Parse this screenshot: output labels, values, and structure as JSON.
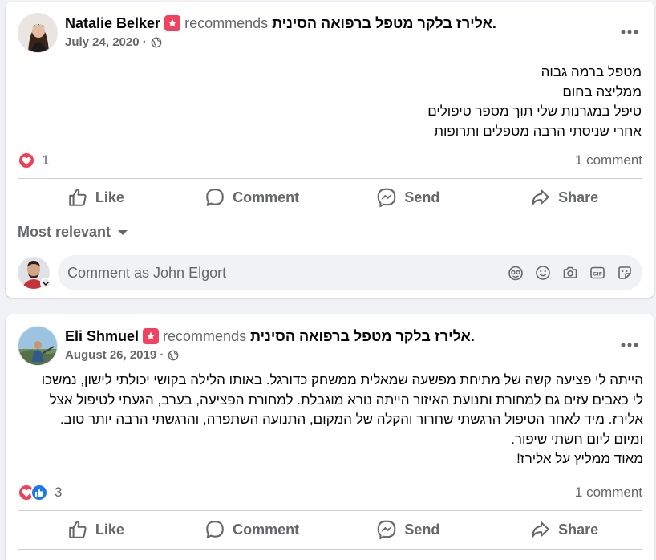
{
  "posts": [
    {
      "author": "Natalie Belker",
      "verb": "recommends",
      "page": "אלירז בלקר מטפל ברפואה הסינית.",
      "date": "July 24, 2020 ·",
      "body": [
        "מטפל ברמה גבוה",
        "ממליצה בחום",
        "טיפל במגרנות שלי תוך מספר טיפולים",
        "אחרי שניסתי הרבה מטפלים ותרופות"
      ],
      "reaction_count": "1",
      "comment_count": "1 comment"
    },
    {
      "author": "Eli Shmuel",
      "verb": "recommends",
      "page": "אלירז בלקר מטפל ברפואה הסינית.",
      "date": "August 26, 2019 ·",
      "body": [
        "הייתה לי פציעה קשה של מתיחת מפשעה שמאלית ממשחק כדורגל. באותו הלילה בקושי יכולתי לישון, נמשכו",
        "לי כאבים עזים גם למחורת ותנועת האיזור הייתה נורא מוגבלת. למחורת הפציעה, בערב, הגעתי לטיפול אצל",
        "אלירז. מיד לאחר הטיפול הרגשתי שחרור והקלה של המקום, התנועה השתפרה, והרגשתי הרבה יותר טוב.",
        "ומיום ליום חשתי שיפור.",
        "מאוד ממליץ על אלירז!"
      ],
      "reaction_count": "3",
      "comment_count": "1 comment"
    }
  ],
  "actions": {
    "like": "Like",
    "comment": "Comment",
    "send": "Send",
    "share": "Share"
  },
  "sort_label": "Most relevant",
  "comment_box": {
    "placeholder": "Comment as John Elgort"
  },
  "icons": {
    "recommend": "recommend-badge-icon",
    "globe": "globe-icon",
    "more": "more-options-icon",
    "love": "love-reaction-icon",
    "like": "like-reaction-icon"
  },
  "colors": {
    "recommend_badge": "#f3425f",
    "love": "#f33e58",
    "like": "#1877f2",
    "muted_text": "#65676b"
  }
}
